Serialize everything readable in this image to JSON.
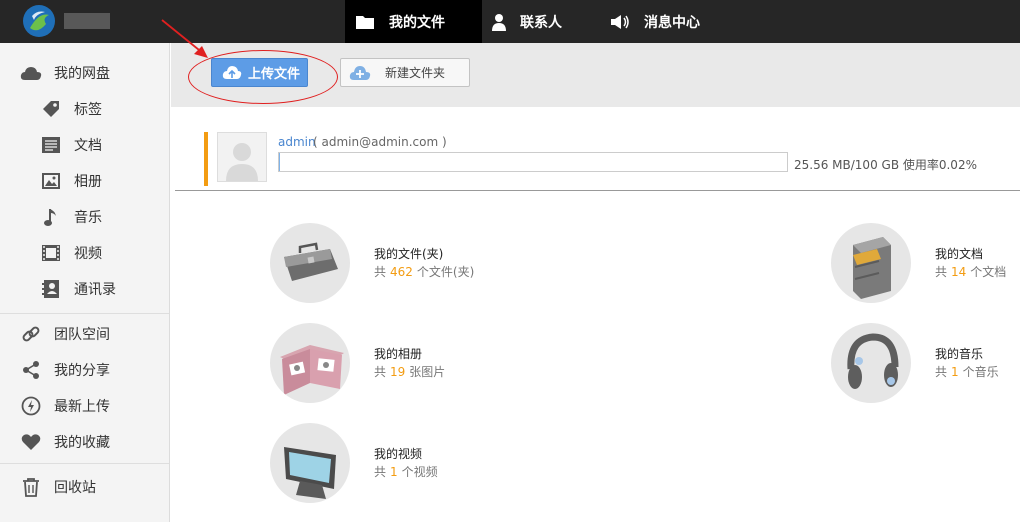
{
  "topbar": {
    "nav": [
      {
        "label": "我的文件",
        "icon": "folder-icon",
        "active": true
      },
      {
        "label": "联系人",
        "icon": "person-icon",
        "active": false
      },
      {
        "label": "消息中心",
        "icon": "speaker-icon",
        "active": false
      }
    ]
  },
  "sidebar": {
    "items": [
      {
        "label": "我的网盘",
        "icon": "cloud-icon"
      },
      {
        "label": "标签",
        "icon": "tag-icon"
      },
      {
        "label": "文档",
        "icon": "document-icon"
      },
      {
        "label": "相册",
        "icon": "image-icon"
      },
      {
        "label": "音乐",
        "icon": "music-note-icon"
      },
      {
        "label": "视频",
        "icon": "film-icon"
      },
      {
        "label": "通讯录",
        "icon": "address-book-icon"
      },
      {
        "label": "团队空间",
        "icon": "link-icon"
      },
      {
        "label": "我的分享",
        "icon": "share-icon"
      },
      {
        "label": "最新上传",
        "icon": "lightning-icon"
      },
      {
        "label": "我的收藏",
        "icon": "heart-icon"
      },
      {
        "label": "回收站",
        "icon": "trash-icon"
      }
    ]
  },
  "toolbar": {
    "upload_label": "上传文件",
    "new_folder_label": "新建文件夹"
  },
  "user": {
    "name": "admin",
    "email": "( admin@admin.com )",
    "quota_text": "25.56 MB/100 GB  使用率0.02%",
    "usage_fraction": 0.0002
  },
  "categories": [
    {
      "title": "我的文件(夹)",
      "prefix": "共",
      "count": "462",
      "suffix": "个文件(夹)",
      "icon": "briefcase-icon"
    },
    {
      "title": "我的文档",
      "prefix": "共",
      "count": "14",
      "suffix": "个文档",
      "icon": "file-cabinet-icon"
    },
    {
      "title": "我的相册",
      "prefix": "共",
      "count": "19",
      "suffix": "张图片",
      "icon": "photo-album-icon"
    },
    {
      "title": "我的音乐",
      "prefix": "共",
      "count": "1",
      "suffix": "个音乐",
      "icon": "headphones-icon"
    },
    {
      "title": "我的视频",
      "prefix": "共",
      "count": "1",
      "suffix": "个视频",
      "icon": "monitor-icon"
    }
  ],
  "colors": {
    "topbar": "#262626",
    "accent_blue": "#5d9ce6",
    "accent_orange": "#f39c12",
    "annotation_red": "#e02020"
  }
}
